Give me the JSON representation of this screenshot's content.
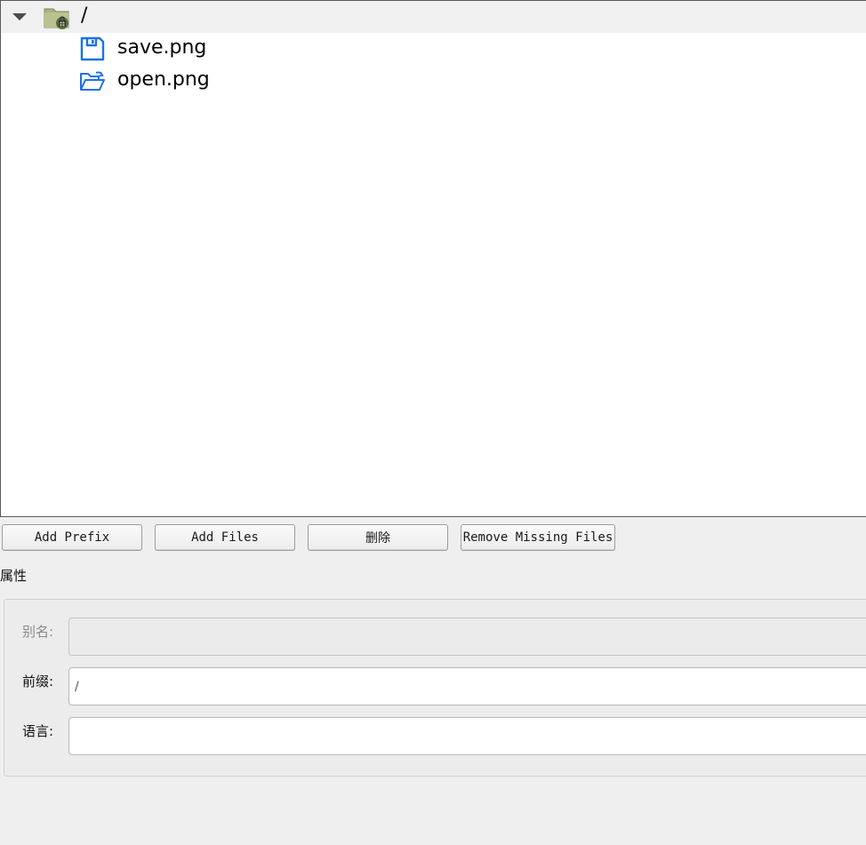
{
  "tree": {
    "root": {
      "label": "/",
      "icon": "resource-folder-icon",
      "expanded": true
    },
    "children": [
      {
        "label": "save.png",
        "icon": "save-icon"
      },
      {
        "label": "open.png",
        "icon": "open-folder-icon"
      }
    ]
  },
  "toolbar": {
    "add_prefix_label": "Add Prefix",
    "add_files_label": "Add Files",
    "delete_label": "删除",
    "remove_missing_label": "Remove Missing Files"
  },
  "properties": {
    "title": "属性",
    "alias_label": "别名:",
    "alias_value": "",
    "prefix_label": "前缀:",
    "prefix_value": "/",
    "language_label": "语言:",
    "language_value": ""
  },
  "colors": {
    "icon_blue": "#1a73e8",
    "folder_green": "#9aa67a"
  }
}
